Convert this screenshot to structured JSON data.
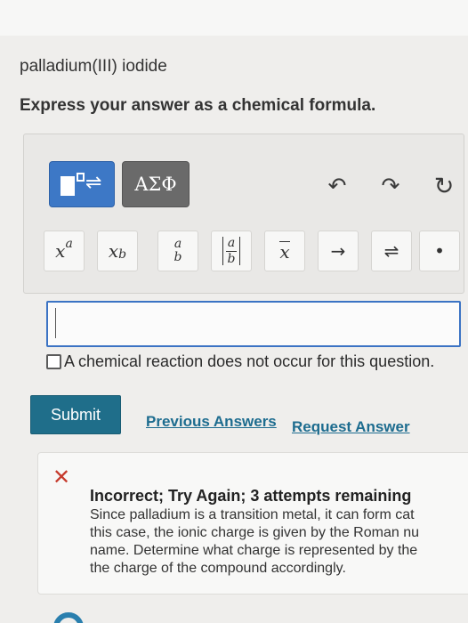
{
  "question": {
    "title": "palladium(III) iodide",
    "instruction": "Express your answer as a chemical formula."
  },
  "toolbar": {
    "greek_label": "ΑΣΦ",
    "icons": [
      "templates-icon",
      "greek-symbols-icon",
      "undo-icon",
      "redo-icon",
      "reset-icon"
    ]
  },
  "symbols": {
    "superscript_base": "x",
    "superscript_exp": "a",
    "subscript_base": "x",
    "subscript_sub": "b",
    "frac_num": "a",
    "frac_den": "b",
    "overbar_char": "x",
    "arrow": "→",
    "equilibrium": "⇌",
    "dot": "•"
  },
  "answer": {
    "value": ""
  },
  "no_reaction": {
    "label": "A chemical reaction does not occur for this question."
  },
  "actions": {
    "submit_label": "Submit",
    "previous_label": "Previous Answers",
    "request_label": "Request Answer"
  },
  "feedback": {
    "title": "Incorrect; Try Again; 3 attempts remaining",
    "lines": [
      "Since palladium is a transition metal, it can form cat",
      "this case, the ionic charge is given by the Roman nu",
      "name. Determine what charge is represented by the",
      "the charge of the compound accordingly."
    ],
    "status_color": "#c63a2c"
  },
  "colors": {
    "accent_blue": "#3d78c6",
    "submit_teal": "#1f6e8a",
    "link": "#1d6c8f"
  }
}
